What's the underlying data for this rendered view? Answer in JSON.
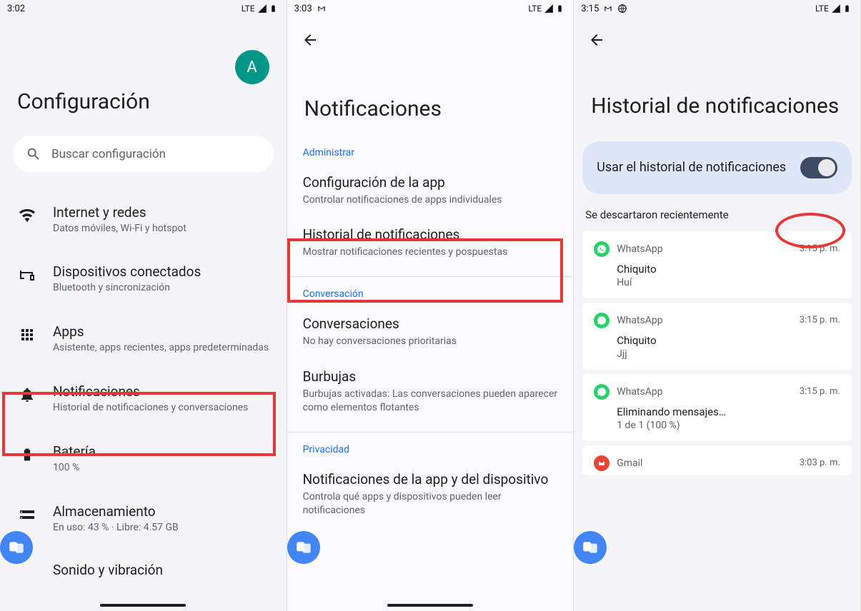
{
  "screen1": {
    "status_time": "3:02",
    "status_lte": "LTE",
    "title": "Configuración",
    "avatar_letter": "A",
    "search_placeholder": "Buscar configuración",
    "items": [
      {
        "title": "Internet y redes",
        "subtitle": "Datos móviles, Wi-Fi y hotspot"
      },
      {
        "title": "Dispositivos conectados",
        "subtitle": "Bluetooth y sincronización"
      },
      {
        "title": "Apps",
        "subtitle": "Asistente, apps recientes, apps predeterminadas"
      },
      {
        "title": "Notificaciones",
        "subtitle": "Historial de notificaciones y conversaciones"
      },
      {
        "title": "Batería",
        "subtitle": "100 %"
      },
      {
        "title": "Almacenamiento",
        "subtitle": "En uso: 43 % · Libre: 4.57 GB"
      }
    ],
    "cutoff": "Sonido y vibración"
  },
  "screen2": {
    "status_time": "3:03",
    "status_lte": "LTE",
    "title": "Notificaciones",
    "sections": {
      "manage": "Administrar",
      "conversation": "Conversación",
      "privacy": "Privacidad"
    },
    "items": {
      "app_config": {
        "title": "Configuración de la app",
        "subtitle": "Controlar notificaciones de apps individuales"
      },
      "history": {
        "title": "Historial de notificaciones",
        "subtitle": "Mostrar notificaciones recientes y pospuestas"
      },
      "conversations": {
        "title": "Conversaciones",
        "subtitle": "No hay conversaciones prioritarias"
      },
      "bubbles": {
        "title": "Burbujas",
        "subtitle": "Burbujas activadas: Las conversaciones pueden aparecer como elementos flotantes"
      },
      "app_device": {
        "title": "Notificaciones de la app y del dispositivo",
        "subtitle": "Controla qué apps y dispositivos pueden leer notificaciones"
      }
    }
  },
  "screen3": {
    "status_time": "3:15",
    "status_lte": "LTE",
    "title": "Historial de notificaciones",
    "toggle_label": "Usar el historial de notificaciones",
    "dismissed_label": "Se descartaron recientemente",
    "notifications": [
      {
        "app": "WhatsApp",
        "time": "3:15 p. m.",
        "title": "Chiquito",
        "body": "Huí"
      },
      {
        "app": "WhatsApp",
        "time": "3:15 p. m.",
        "title": "Chiquito",
        "body": "Jjj"
      },
      {
        "app": "WhatsApp",
        "time": "3:15 p. m.",
        "title": "Eliminando mensajes…",
        "body": "1 de 1 (100 %)"
      },
      {
        "app": "Gmail",
        "time": "3:03 p. m.",
        "title": "",
        "body": ""
      }
    ]
  }
}
